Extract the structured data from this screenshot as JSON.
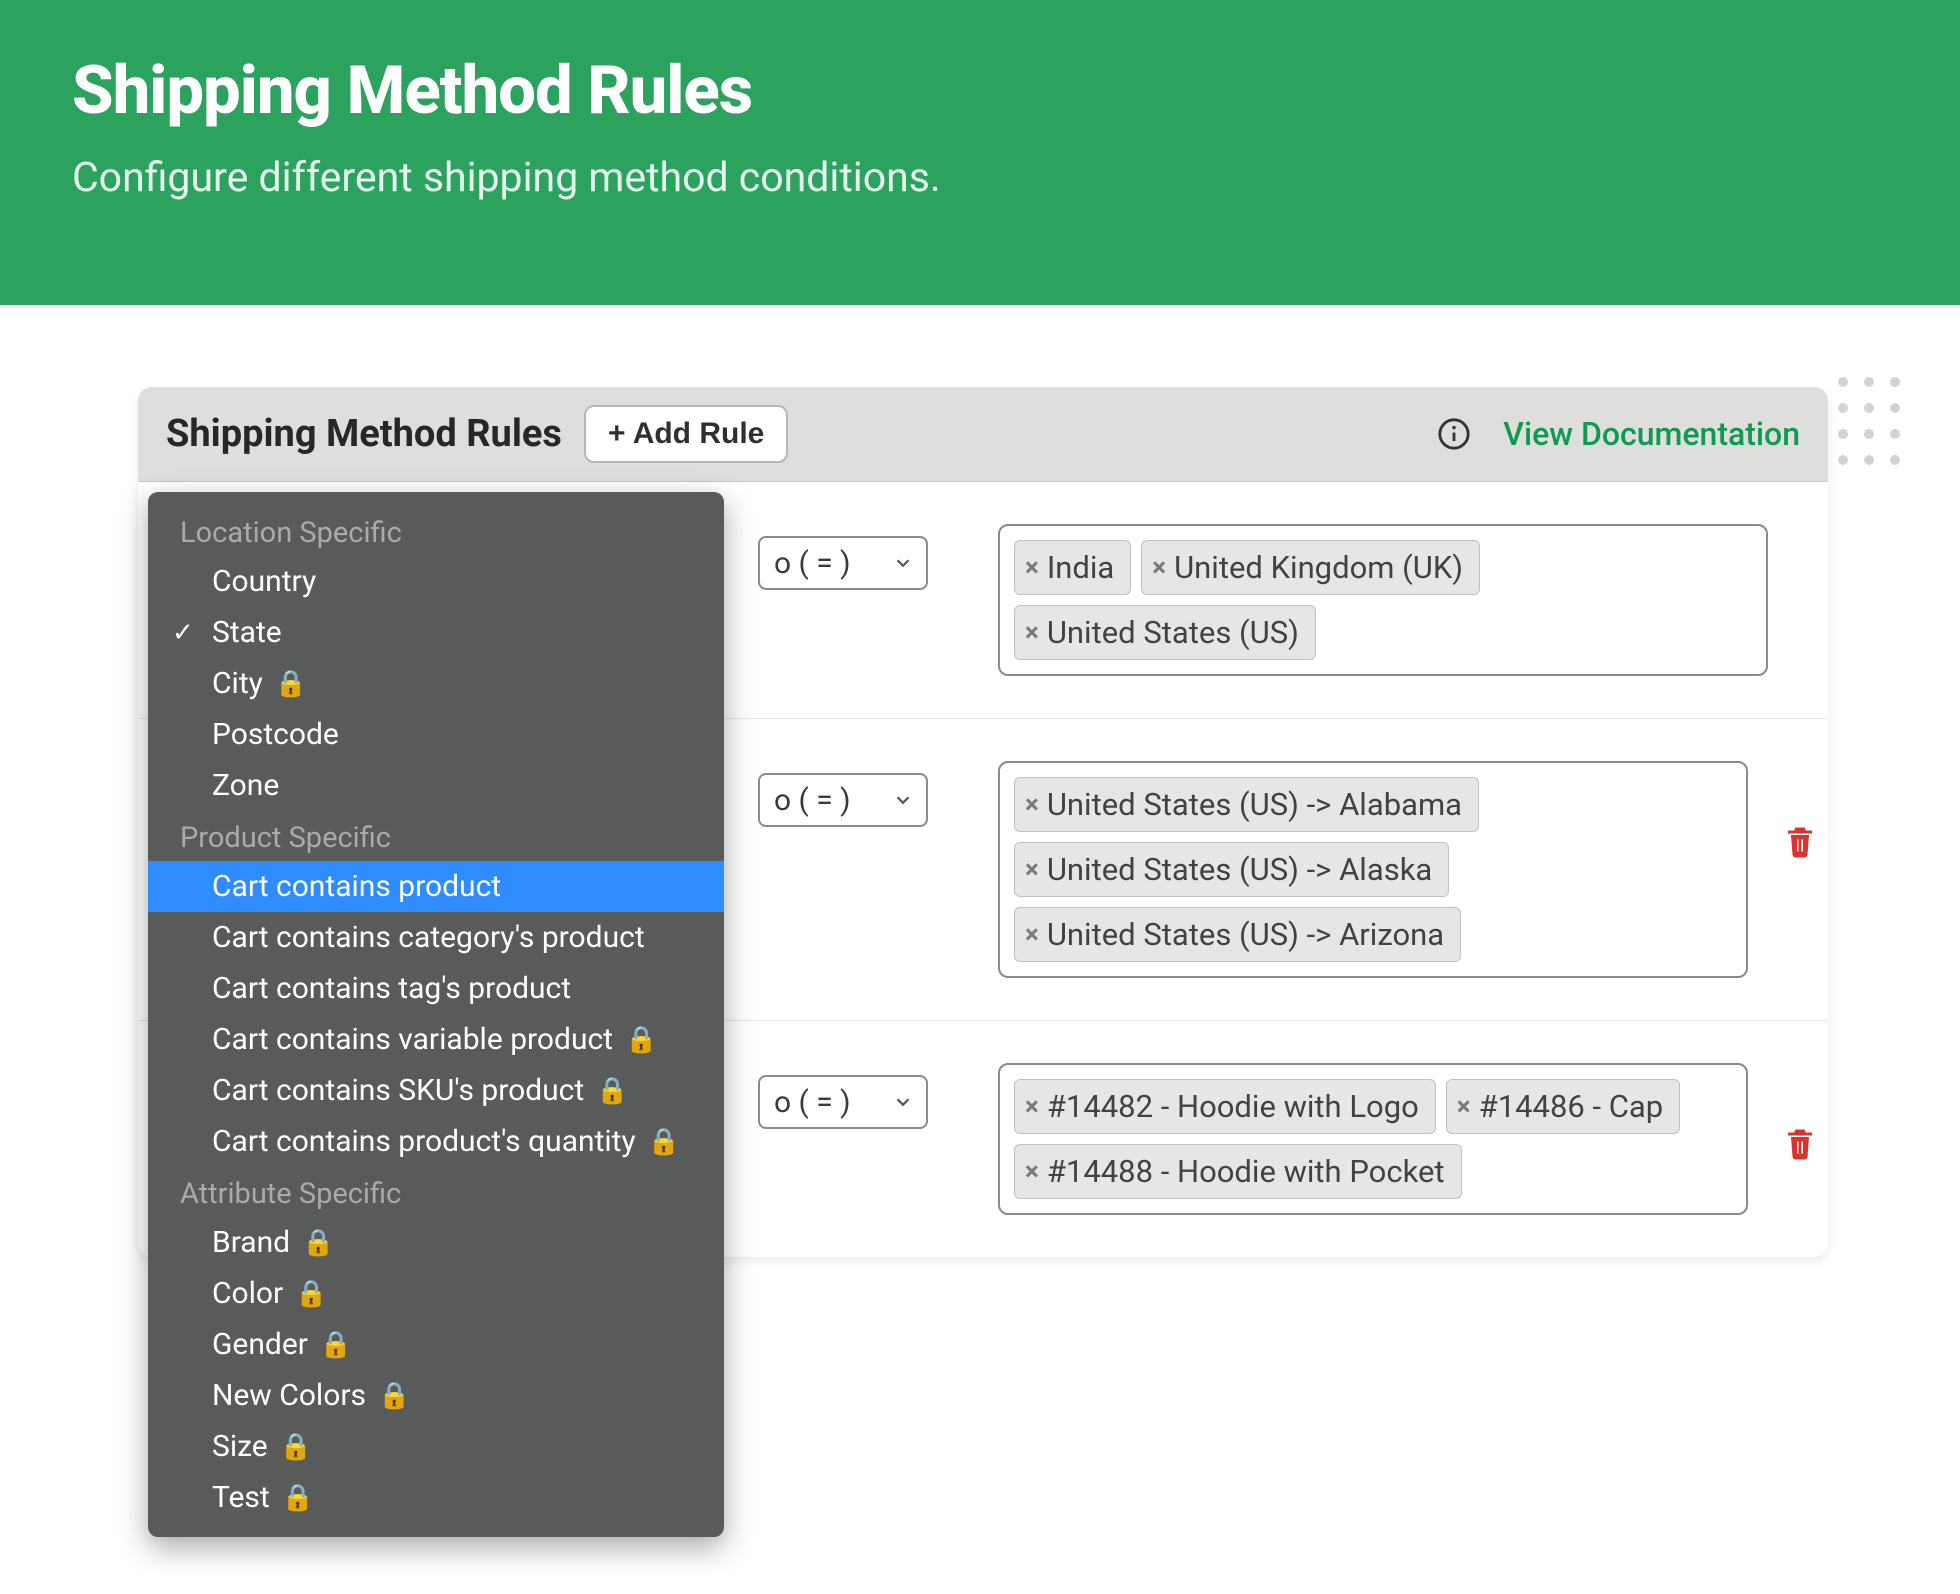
{
  "hero": {
    "title": "Shipping Method Rules",
    "subtitle": "Configure different shipping method conditions."
  },
  "panel": {
    "title": "Shipping Method Rules",
    "add_rule_label": "+ Add Rule",
    "view_docs_label": "View Documentation"
  },
  "operator": {
    "visible_fragment": "o ( = )"
  },
  "rules": [
    {
      "tags": [
        "India",
        "United Kingdom (UK)",
        "United States (US)"
      ],
      "deletable": false
    },
    {
      "tags": [
        "United States (US) -> Alabama",
        "United States (US) -> Alaska",
        "United States (US) -> Arizona"
      ],
      "deletable": true
    },
    {
      "tags": [
        "#14482 - Hoodie with Logo",
        "#14486 - Cap",
        "#14488 - Hoodie with Pocket"
      ],
      "deletable": true
    }
  ],
  "dropdown": {
    "groups": [
      {
        "label": "Location Specific",
        "items": [
          {
            "label": "Country",
            "checked": false,
            "locked": false
          },
          {
            "label": "State",
            "checked": true,
            "locked": false
          },
          {
            "label": "City",
            "checked": false,
            "locked": true
          },
          {
            "label": "Postcode",
            "checked": false,
            "locked": false
          },
          {
            "label": "Zone",
            "checked": false,
            "locked": false
          }
        ]
      },
      {
        "label": "Product Specific",
        "items": [
          {
            "label": "Cart contains product",
            "checked": false,
            "locked": false,
            "highlight": true
          },
          {
            "label": "Cart contains category's product",
            "checked": false,
            "locked": false
          },
          {
            "label": "Cart contains tag's product",
            "checked": false,
            "locked": false
          },
          {
            "label": "Cart contains variable product",
            "checked": false,
            "locked": true
          },
          {
            "label": "Cart contains SKU's product",
            "checked": false,
            "locked": true
          },
          {
            "label": "Cart contains product's quantity",
            "checked": false,
            "locked": true
          }
        ]
      },
      {
        "label": "Attribute Specific",
        "items": [
          {
            "label": "Brand",
            "checked": false,
            "locked": true
          },
          {
            "label": "Color",
            "checked": false,
            "locked": true
          },
          {
            "label": "Gender",
            "checked": false,
            "locked": true
          },
          {
            "label": "New Colors",
            "checked": false,
            "locked": true
          },
          {
            "label": "Size",
            "checked": false,
            "locked": true
          },
          {
            "label": "Test",
            "checked": false,
            "locked": true
          }
        ]
      }
    ]
  },
  "icons": {
    "lock": "🔒",
    "check": "✓",
    "close": "×"
  }
}
